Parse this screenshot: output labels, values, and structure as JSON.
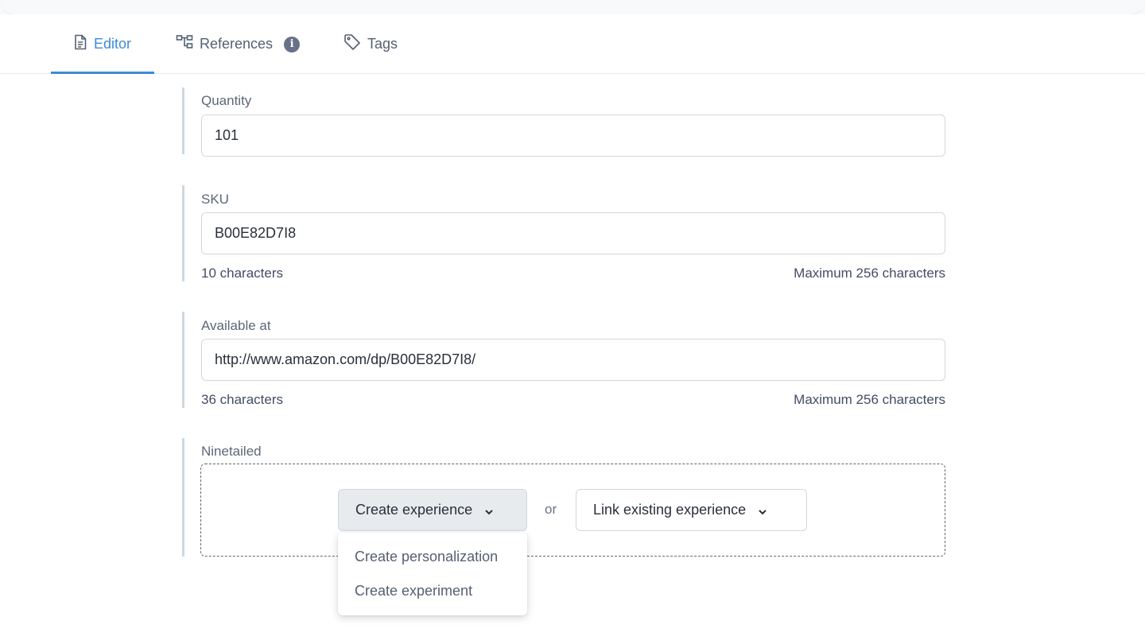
{
  "tabs": [
    {
      "label": "Editor",
      "icon": "document-icon",
      "active": true
    },
    {
      "label": "References",
      "icon": "references-tree-icon",
      "badge": "i"
    },
    {
      "label": "Tags",
      "icon": "tag-icon"
    }
  ],
  "fields": {
    "quantity": {
      "label": "Quantity",
      "value": "101"
    },
    "sku": {
      "label": "SKU",
      "value": "B00E82D7I8",
      "count": "10 characters",
      "max": "Maximum 256 characters"
    },
    "available_at": {
      "label": "Available at",
      "value": "http://www.amazon.com/dp/B00E82D7I8/",
      "count": "36 characters",
      "max": "Maximum 256 characters"
    }
  },
  "ninetailed": {
    "label": "Ninetailed",
    "create_button": "Create experience",
    "or_text": "or",
    "link_button": "Link existing experience",
    "dropdown_items": [
      "Create personalization",
      "Create experiment"
    ]
  },
  "colors": {
    "accent": "#3d8ad6",
    "text": "#414d63",
    "border": "#cfd9e0"
  }
}
